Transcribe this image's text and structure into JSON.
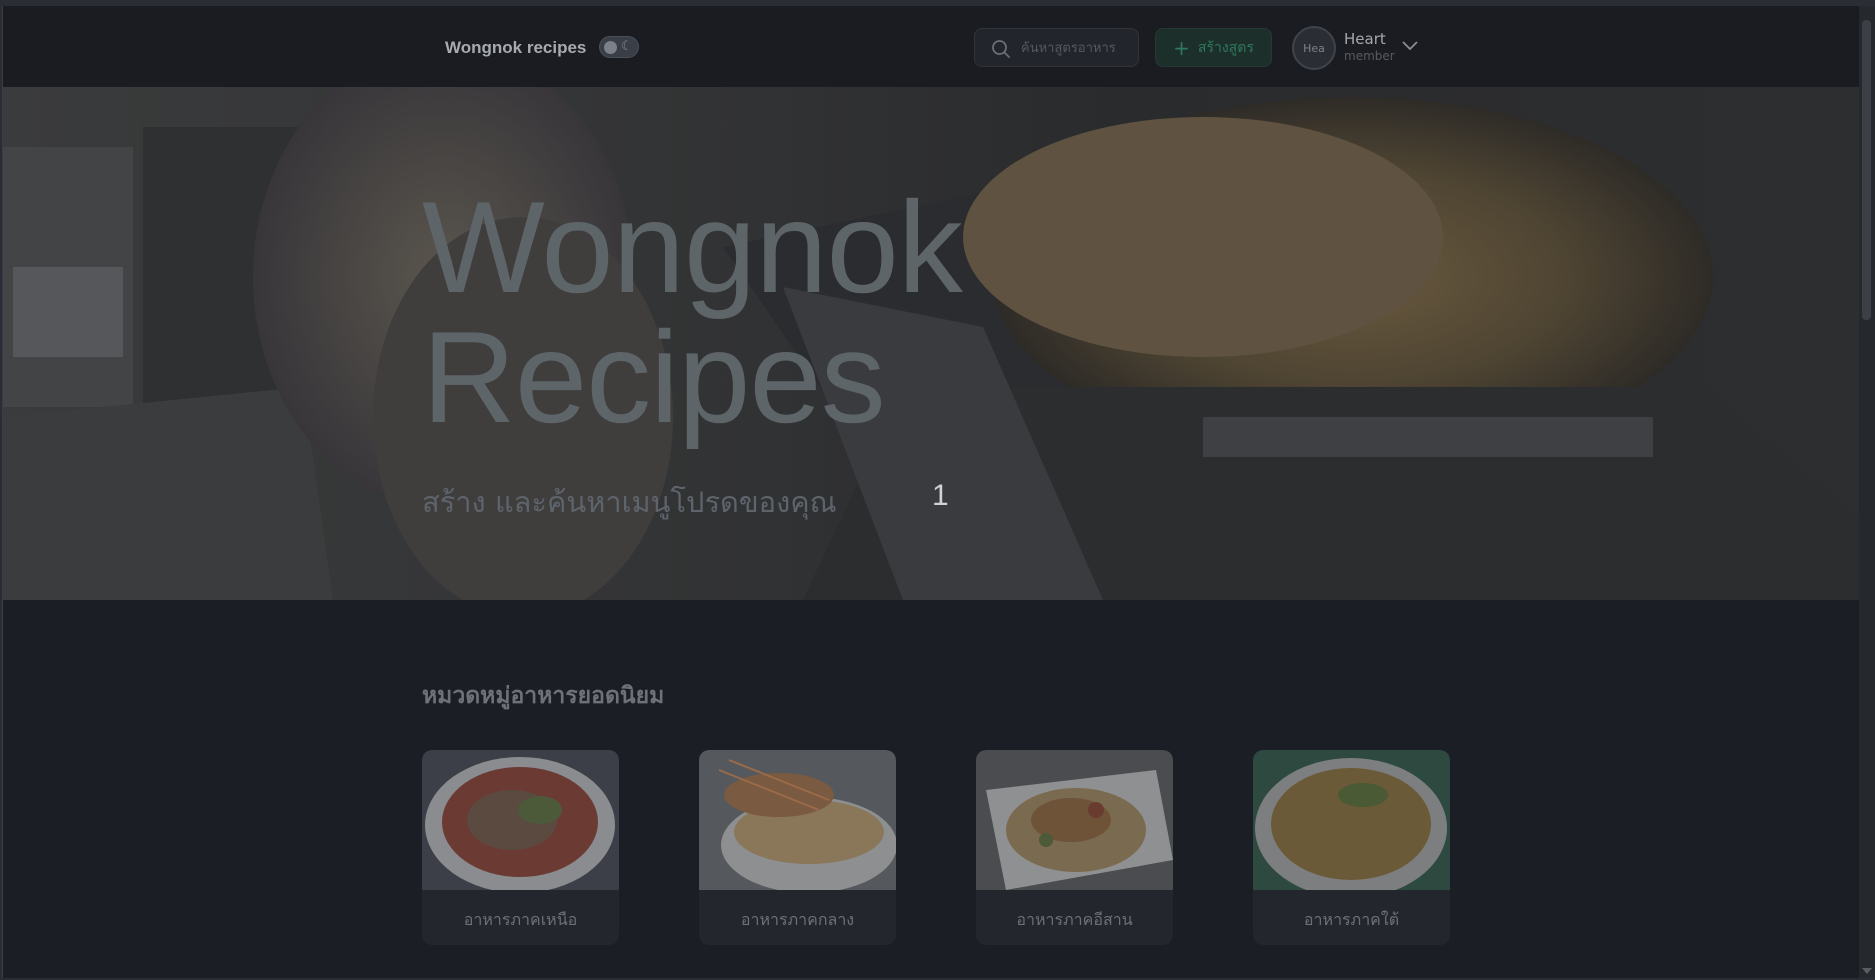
{
  "header": {
    "brand": "Wongnok recipes",
    "search_placeholder": "ค้นหาสูตรอาหาร",
    "create_label": "สร้างสูตร",
    "avatar_text": "Hea",
    "user_name": "Heart",
    "user_role": "member"
  },
  "hero": {
    "title_line1": "Wongnok",
    "title_line2": "Recipes",
    "subtitle": "สร้าง และค้นหาเมนูโปรดของคุณ",
    "counter": "1"
  },
  "categories": {
    "title": "หมวดหมู่อาหารยอดนิยม",
    "items": [
      {
        "label": "อาหารภาคเหนือ"
      },
      {
        "label": "อาหารภาคกลาง"
      },
      {
        "label": "อาหารภาคอีสาน"
      },
      {
        "label": "อาหารภาคใต้"
      }
    ]
  },
  "colors": {
    "accent_green": "#2e7a5c",
    "background": "#1b1e24"
  },
  "icons": {
    "search": "search-icon",
    "plus": "plus-icon",
    "moon": "moon-icon",
    "chevron": "chevron-down-icon"
  }
}
